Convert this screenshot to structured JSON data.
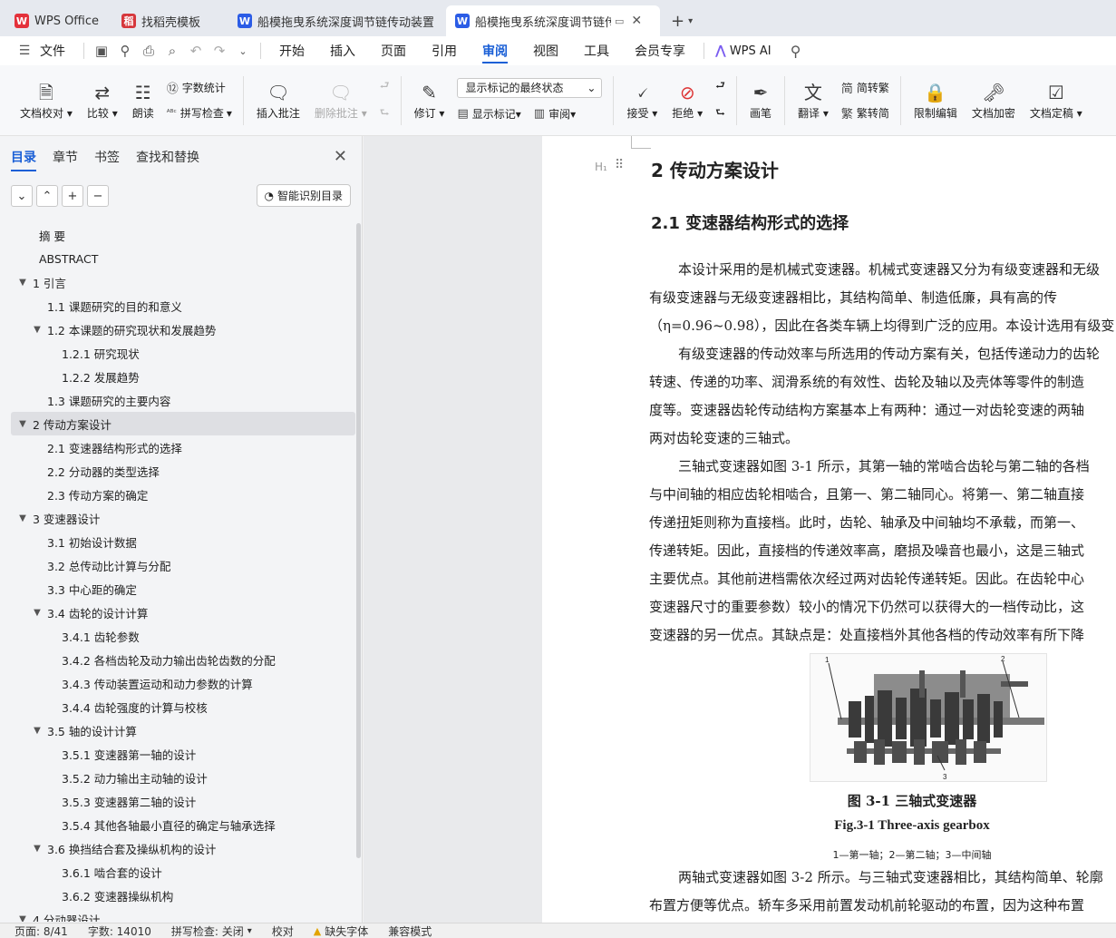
{
  "tabs": [
    {
      "label": "WPS Office",
      "icon": "wps-logo",
      "glyph": "W"
    },
    {
      "label": "找稻壳模板",
      "icon": "template-logo",
      "glyph": "稻"
    },
    {
      "label": "船模拖曳系统深度调节链传动装置设计",
      "icon": "writer-logo",
      "glyph": "W"
    },
    {
      "label": "船模拖曳系统深度调节链传动",
      "icon": "writer-logo",
      "glyph": "W"
    }
  ],
  "menu": {
    "file": "文件",
    "items": [
      "开始",
      "插入",
      "页面",
      "引用",
      "审阅",
      "视图",
      "工具",
      "会员专享"
    ],
    "active": "审阅",
    "wps_ai": "WPS AI"
  },
  "ribbon": {
    "doc_check": "文档校对",
    "compare": "比较",
    "read_aloud": "朗读",
    "word_count": "字数统计",
    "spell_check": "拼写检查",
    "insert_comment": "插入批注",
    "delete_comment": "删除批注",
    "revise": "修订",
    "markup_state": "显示标记的最终状态",
    "show_markup": "显示标记",
    "review_pane": "审阅",
    "accept": "接受",
    "reject": "拒绝",
    "pen": "画笔",
    "translate": "翻译",
    "to_traditional": "简转繁",
    "to_simplified": "繁转简",
    "restrict_edit": "限制编辑",
    "encrypt": "文档加密",
    "finalize": "文档定稿"
  },
  "sidebar": {
    "tabs": [
      "目录",
      "章节",
      "书签",
      "查找和替换"
    ],
    "smart_toc": "智能识别目录",
    "toc": [
      {
        "label": "摘 要",
        "level": 1,
        "arrow": ""
      },
      {
        "label": "ABSTRACT",
        "level": 1,
        "arrow": ""
      },
      {
        "label": "1 引言",
        "level": 1,
        "arrow": "▼"
      },
      {
        "label": "1.1 课题研究的目的和意义",
        "level": 2,
        "arrow": ""
      },
      {
        "label": "1.2 本课题的研究现状和发展趋势",
        "level": 2,
        "arrow": "▼"
      },
      {
        "label": "1.2.1 研究现状",
        "level": 3,
        "arrow": ""
      },
      {
        "label": "1.2.2 发展趋势",
        "level": 3,
        "arrow": ""
      },
      {
        "label": "1.3 课题研究的主要内容",
        "level": 2,
        "arrow": ""
      },
      {
        "label": "2 传动方案设计",
        "level": 1,
        "arrow": "▼",
        "selected": true
      },
      {
        "label": "2.1 变速器结构形式的选择",
        "level": 2,
        "arrow": ""
      },
      {
        "label": "2.2 分动器的类型选择",
        "level": 2,
        "arrow": ""
      },
      {
        "label": "2.3 传动方案的确定",
        "level": 2,
        "arrow": ""
      },
      {
        "label": "3 变速器设计",
        "level": 1,
        "arrow": "▼"
      },
      {
        "label": "3.1 初始设计数据",
        "level": 2,
        "arrow": ""
      },
      {
        "label": "3.2 总传动比计算与分配",
        "level": 2,
        "arrow": ""
      },
      {
        "label": "3.3 中心距的确定",
        "level": 2,
        "arrow": ""
      },
      {
        "label": "3.4 齿轮的设计计算",
        "level": 2,
        "arrow": "▼"
      },
      {
        "label": "3.4.1 齿轮参数",
        "level": 3,
        "arrow": ""
      },
      {
        "label": "3.4.2 各档齿轮及动力输出齿轮齿数的分配",
        "level": 3,
        "arrow": ""
      },
      {
        "label": "3.4.3 传动装置运动和动力参数的计算",
        "level": 3,
        "arrow": ""
      },
      {
        "label": "3.4.4 齿轮强度的计算与校核",
        "level": 3,
        "arrow": ""
      },
      {
        "label": "3.5 轴的设计计算",
        "level": 2,
        "arrow": "▼"
      },
      {
        "label": "3.5.1 变速器第一轴的设计",
        "level": 3,
        "arrow": ""
      },
      {
        "label": "3.5.2 动力输出主动轴的设计",
        "level": 3,
        "arrow": ""
      },
      {
        "label": "3.5.3 变速器第二轴的设计",
        "level": 3,
        "arrow": ""
      },
      {
        "label": "3.5.4 其他各轴最小直径的确定与轴承选择",
        "level": 3,
        "arrow": ""
      },
      {
        "label": "3.6 换挡结合套及操纵机构的设计",
        "level": 2,
        "arrow": "▼"
      },
      {
        "label": "3.6.1 啮合套的设计",
        "level": 3,
        "arrow": ""
      },
      {
        "label": "3.6.2 变速器操纵机构",
        "level": 3,
        "arrow": ""
      },
      {
        "label": "4 分动器设计",
        "level": 1,
        "arrow": "▼"
      }
    ]
  },
  "document": {
    "h1": "2  传动方案设计",
    "h2": "2.1  变速器结构形式的选择",
    "h1_marker": "H₁",
    "lines": [
      {
        "text": "本设计采用的是机械式变速器。机械式变速器又分为有级变速器和无级",
        "indent": true
      },
      {
        "text": "有级变速器与无级变速器相比，其结构简单、制造低廉，具有高的传",
        "indent": false
      },
      {
        "text": "（η=0.96~0.98），因此在各类车辆上均得到广泛的应用。本设计选用有级变",
        "indent": false
      },
      {
        "text": "有级变速器的传动效率与所选用的传动方案有关，包括传递动力的齿轮",
        "indent": true
      },
      {
        "text": "转速、传递的功率、润滑系统的有效性、齿轮及轴以及壳体等零件的制造",
        "indent": false
      },
      {
        "text": "度等。变速器齿轮传动结构方案基本上有两种：通过一对齿轮变速的两轴",
        "indent": false
      },
      {
        "text": "两对齿轮变速的三轴式。",
        "indent": false
      },
      {
        "text": "三轴式变速器如图 3-1 所示，其第一轴的常啮合齿轮与第二轴的各档",
        "indent": true
      },
      {
        "text": "与中间轴的相应齿轮相啮合，且第一、第二轴同心。将第一、第二轴直接",
        "indent": false
      },
      {
        "text": "传递扭矩则称为直接档。此时，齿轮、轴承及中间轴均不承载，而第一、",
        "indent": false
      },
      {
        "text": "传递转矩。因此，直接档的传递效率高，磨损及噪音也最小，这是三轴式",
        "indent": false
      },
      {
        "text": "主要优点。其他前进档需依次经过两对齿轮传递转矩。因此。在齿轮中心",
        "indent": false
      },
      {
        "text": "变速器尺寸的重要参数）较小的情况下仍然可以获得大的一档传动比，这",
        "indent": false
      },
      {
        "text": "变速器的另一优点。其缺点是：处直接档外其他各档的传动效率有所下降",
        "indent": false
      }
    ],
    "figure": {
      "caption_cn": "图 3-1    三轴式变速器",
      "caption_en": "Fig.3-1 Three-axis gearbox",
      "note": "1—第一轴；2—第二轴；3—中间轴",
      "labels": [
        "1",
        "2",
        "3"
      ]
    },
    "lines_after": [
      {
        "text": "两轴式变速器如图 3-2 所示。与三轴式变速器相比，其结构简单、轮廓",
        "indent": true
      },
      {
        "text": "布置方便等优点。轿车多采用前置发动机前轮驱动的布置，因为这种布置",
        "indent": false
      }
    ]
  },
  "statusbar": {
    "page": "页面: 8/41",
    "words": "字数: 14010",
    "spell": "拼写检查: 关闭",
    "proof": "校对",
    "missing_font": "缺失字体",
    "compat": "兼容模式"
  }
}
